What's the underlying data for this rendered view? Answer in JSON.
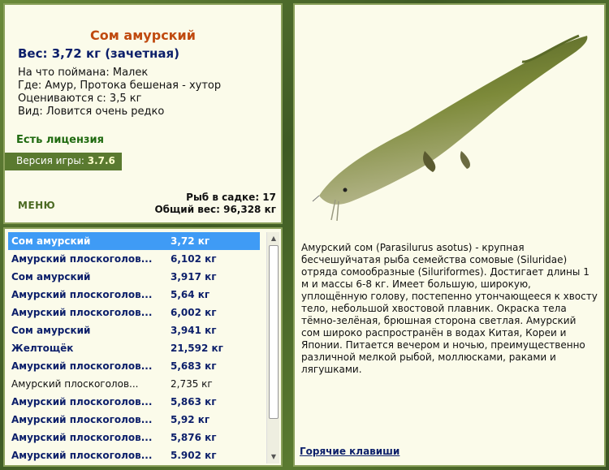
{
  "fish": {
    "name": "Сом амурский",
    "weight": "Вес: 3,72 кг (зачетная)",
    "caught_on": "На что поймана: Малек",
    "where": "Где: Амур, Протока бешеная - хутор",
    "value": "Оцениваются с: 3,5 кг",
    "kind": "Вид: Ловится очень редко"
  },
  "license": "Есть лицензия",
  "version": {
    "label": "Версия игры: ",
    "number": "3.7.6"
  },
  "menu_label": "МЕНЮ",
  "stats": {
    "count": "Рыб в садке: 17",
    "total": "Общий вес: 96,328 кг"
  },
  "catch_list": [
    {
      "name": "Сом амурский",
      "weight": "3,72 кг"
    },
    {
      "name": "Амурский плоскоголов...",
      "weight": "6,102 кг"
    },
    {
      "name": "Сом амурский",
      "weight": "3,917 кг"
    },
    {
      "name": "Амурский плоскоголов...",
      "weight": "5,64 кг"
    },
    {
      "name": "Амурский плоскоголов...",
      "weight": "6,002 кг"
    },
    {
      "name": "Сом амурский",
      "weight": "3,941 кг"
    },
    {
      "name": "Желтощёк",
      "weight": "21,592 кг"
    },
    {
      "name": "Амурский плоскоголов...",
      "weight": "5,683 кг"
    },
    {
      "name": "Амурский плоскоголов...",
      "weight": "2,735 кг"
    },
    {
      "name": "Амурский плоскоголов...",
      "weight": "5,863 кг"
    },
    {
      "name": "Амурский плоскоголов...",
      "weight": "5,92 кг"
    },
    {
      "name": "Амурский плоскоголов...",
      "weight": "5,876 кг"
    },
    {
      "name": "Амурский плоскоголов...",
      "weight": "5.902 кг"
    }
  ],
  "description": "Амурский сом (Parasilurus asotus) - крупная бесчешуйчатая рыба семейства сомовые (Siluridae) отряда сомообразные (Siluriformes). Достигает длины 1 м и массы 6-8 кг. Имеет большую, широкую, уплощённую голову, постепенно утончающееся к хвосту тело, небольшой хвостовой плавник. Окраска тела тёмно-зелёная, брюшная сторона светлая. Амурский сом широко распространён в водах Китая, Кореи и Японии. Питается вечером и ночью, преимущественно различной мелкой рыбой, моллюсками, раками и лягушками.",
  "hotkeys_label": "Горячие клавиши",
  "colors": {
    "selected": "#3f9bf5",
    "title": "#c04a10",
    "panel": "#fbfbea"
  }
}
